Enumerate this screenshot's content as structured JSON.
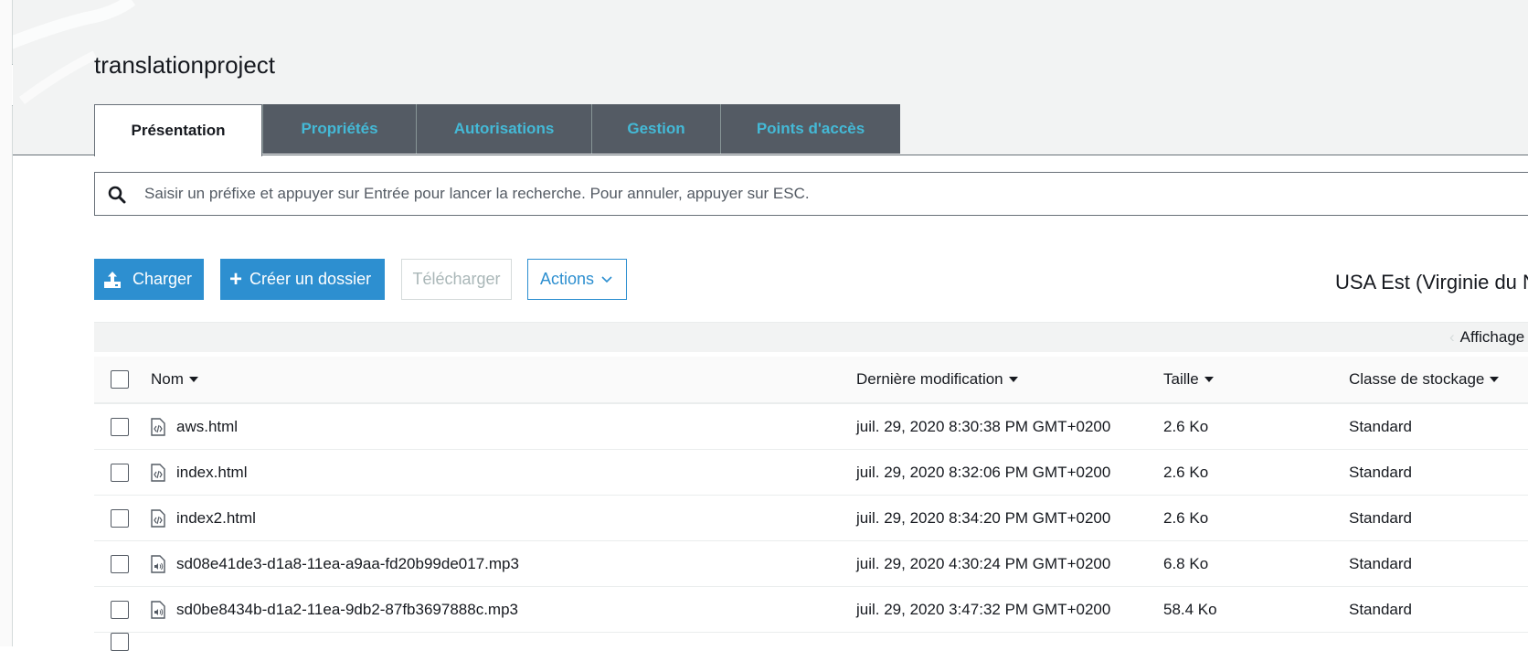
{
  "bucket": {
    "title": "translationproject"
  },
  "tabs": [
    {
      "label": "Présentation",
      "active": true
    },
    {
      "label": "Propriétés",
      "active": false
    },
    {
      "label": "Autorisations",
      "active": false
    },
    {
      "label": "Gestion",
      "active": false
    },
    {
      "label": "Points d'accès",
      "active": false
    }
  ],
  "search": {
    "placeholder": "Saisir un préfixe et appuyer sur Entrée pour lancer la recherche. Pour annuler, appuyer sur ESC."
  },
  "toolbar": {
    "upload_label": "Charger",
    "create_folder_label": "Créer un dossier",
    "download_label": "Télécharger",
    "actions_label": "Actions"
  },
  "region": "USA Est (Virginie du Nord)",
  "view": {
    "label": "Affichage"
  },
  "table": {
    "headers": {
      "name": "Nom",
      "modified": "Dernière modification",
      "size": "Taille",
      "storage_class": "Classe de stockage"
    },
    "rows": [
      {
        "name": "aws.html",
        "modified": "juil. 29, 2020 8:30:38 PM GMT+0200",
        "size": "2.6 Ko",
        "storage_class": "Standard",
        "icon": "code-file-icon"
      },
      {
        "name": "index.html",
        "modified": "juil. 29, 2020 8:32:06 PM GMT+0200",
        "size": "2.6 Ko",
        "storage_class": "Standard",
        "icon": "code-file-icon"
      },
      {
        "name": "index2.html",
        "modified": "juil. 29, 2020 8:34:20 PM GMT+0200",
        "size": "2.6 Ko",
        "storage_class": "Standard",
        "icon": "code-file-icon"
      },
      {
        "name": "sd08e41de3-d1a8-11ea-a9aa-fd20b99de017.mp3",
        "modified": "juil. 29, 2020 4:30:24 PM GMT+0200",
        "size": "6.8 Ko",
        "storage_class": "Standard",
        "icon": "audio-file-icon"
      },
      {
        "name": "sd0be8434b-d1a2-11ea-9db2-87fb3697888c.mp3",
        "modified": "juil. 29, 2020 3:47:32 PM GMT+0200",
        "size": "58.4 Ko",
        "storage_class": "Standard",
        "icon": "audio-file-icon"
      }
    ]
  },
  "colors": {
    "accent": "#2d8fd0",
    "tab_text": "#44b9d6",
    "tab_bg": "#545b64",
    "header_bg": "#f2f3f3"
  }
}
